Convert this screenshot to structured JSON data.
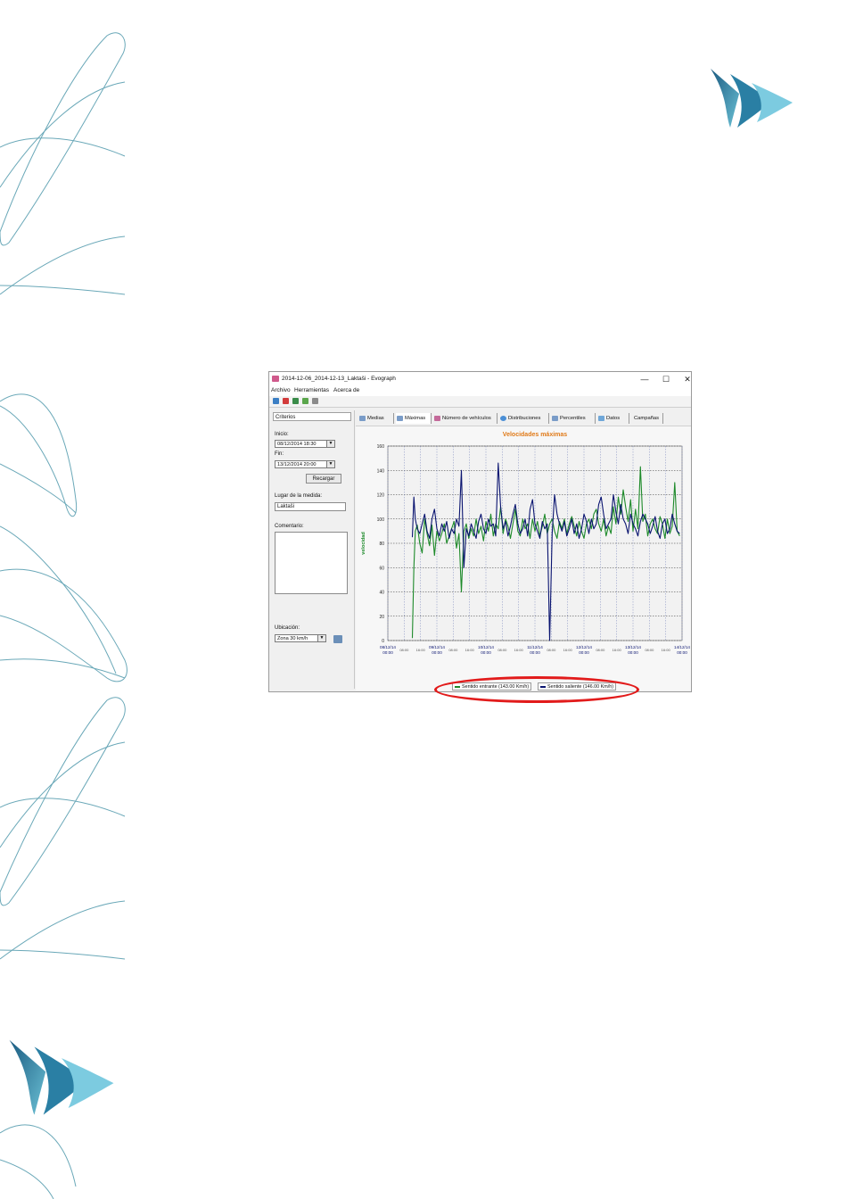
{
  "window": {
    "title": "2014-12-06_2014-12-13_Laktaši - Evograph",
    "controls": {
      "minimize": "—",
      "maximize": "☐",
      "close": "✕"
    }
  },
  "menu": [
    "Archivo",
    "Herramientas",
    "Acerca de"
  ],
  "toolbar_icons": [
    "open-folder-icon",
    "pdf-icon",
    "save-icon",
    "export-icon",
    "print-icon"
  ],
  "left_panel": {
    "header": "Criterios",
    "inicio_label": "Inicio:",
    "inicio_value": "08/12/2014 18:30",
    "fin_label": "Fin:",
    "fin_value": "13/12/2014 20:00",
    "reload_button": "Recargar",
    "lugar_label": "Lugar de la medida:",
    "lugar_value": "Laktaši",
    "comentario_label": "Comentario:",
    "comentario_value": "",
    "ubicacion_label": "Ubicación:",
    "ubicacion_value": "Zona 30 km/h"
  },
  "tabs": [
    "Medias",
    "Máximas",
    "Número de vehículos",
    "Distribuciones",
    "Percentiles",
    "Datos",
    "Campañas"
  ],
  "colors": {
    "incoming": "#1d8a2a",
    "outgoing": "#0a1470",
    "title": "#e07b1a",
    "highlight": "#e21b1b",
    "ylabel": "#1d8a2a"
  },
  "chart_data": {
    "type": "line",
    "title": "Velocidades máximas",
    "ylabel": "velocidad",
    "xlabel": "",
    "ylim": [
      0,
      160
    ],
    "yticks": [
      0,
      20,
      40,
      60,
      80,
      100,
      120,
      140,
      160
    ],
    "x_major_labels": [
      {
        "date": "08/12/14",
        "time": "00:00"
      },
      {
        "date": "09/12/14",
        "time": "00:00"
      },
      {
        "date": "10/12/14",
        "time": "00:00"
      },
      {
        "date": "11/12/14",
        "time": "00:00"
      },
      {
        "date": "12/12/14",
        "time": "00:00"
      },
      {
        "date": "13/12/14",
        "time": "00:00"
      },
      {
        "date": "14/12/14",
        "time": "00:00"
      }
    ],
    "x_minor_labels": [
      "08:00",
      "16:00"
    ],
    "x_range_days": [
      0,
      6
    ],
    "series": [
      {
        "name": "Sentido entrante (143.00 Km/h)",
        "x_days": [
          0.5,
          0.53,
          0.56,
          0.6,
          0.65,
          0.7,
          0.75,
          0.8,
          0.85,
          0.9,
          0.95,
          1.0,
          1.05,
          1.1,
          1.15,
          1.2,
          1.25,
          1.3,
          1.35,
          1.4,
          1.45,
          1.5,
          1.55,
          1.6,
          1.65,
          1.7,
          1.75,
          1.8,
          1.85,
          1.9,
          1.95,
          2.0,
          2.05,
          2.1,
          2.15,
          2.2,
          2.25,
          2.3,
          2.35,
          2.4,
          2.45,
          2.5,
          2.55,
          2.6,
          2.65,
          2.7,
          2.75,
          2.8,
          2.85,
          2.9,
          2.95,
          3.0,
          3.05,
          3.1,
          3.15,
          3.2,
          3.25,
          3.3,
          3.35,
          3.4,
          3.45,
          3.5,
          3.55,
          3.6,
          3.65,
          3.7,
          3.75,
          3.8,
          3.85,
          3.9,
          3.95,
          4.0,
          4.05,
          4.1,
          4.15,
          4.2,
          4.25,
          4.3,
          4.35,
          4.4,
          4.45,
          4.5,
          4.55,
          4.6,
          4.65,
          4.7,
          4.75,
          4.8,
          4.85,
          4.9,
          4.95,
          5.0,
          5.05,
          5.1,
          5.15,
          5.2,
          5.25,
          5.3,
          5.35,
          5.4,
          5.45,
          5.5,
          5.55,
          5.6,
          5.65,
          5.7,
          5.75,
          5.8,
          5.85,
          5.9,
          5.95
        ],
        "values": [
          2,
          60,
          90,
          95,
          80,
          72,
          100,
          88,
          78,
          95,
          70,
          90,
          82,
          88,
          96,
          80,
          86,
          92,
          98,
          76,
          88,
          40,
          90,
          96,
          84,
          92,
          86,
          100,
          88,
          94,
          82,
          98,
          90,
          104,
          86,
          96,
          92,
          110,
          88,
          100,
          94,
          84,
          96,
          108,
          90,
          86,
          100,
          92,
          96,
          84,
          100,
          90,
          98,
          86,
          94,
          104,
          88,
          96,
          100,
          90,
          84,
          98,
          92,
          100,
          88,
          96,
          102,
          94,
          86,
          98,
          90,
          84,
          96,
          100,
          92,
          104,
          108,
          96,
          90,
          100,
          86,
          94,
          88,
          110,
          96,
          118,
          104,
          124,
          110,
          98,
          116,
          90,
          108,
          92,
          143,
          98,
          104,
          86,
          96,
          100,
          92,
          88,
          102,
          96,
          84,
          100,
          88,
          94,
          130,
          90,
          86,
          96,
          90
        ]
      },
      {
        "name": "Sentido saliente (146.00 Km/h)",
        "x_days": [
          0.5,
          0.53,
          0.56,
          0.6,
          0.65,
          0.7,
          0.75,
          0.8,
          0.85,
          0.9,
          0.95,
          1.0,
          1.05,
          1.1,
          1.15,
          1.2,
          1.25,
          1.3,
          1.35,
          1.4,
          1.45,
          1.5,
          1.55,
          1.6,
          1.65,
          1.7,
          1.75,
          1.8,
          1.85,
          1.9,
          1.95,
          2.0,
          2.05,
          2.1,
          2.15,
          2.2,
          2.25,
          2.3,
          2.35,
          2.4,
          2.45,
          2.5,
          2.55,
          2.6,
          2.65,
          2.7,
          2.75,
          2.8,
          2.85,
          2.9,
          2.95,
          3.0,
          3.05,
          3.1,
          3.15,
          3.2,
          3.25,
          3.3,
          3.35,
          3.4,
          3.45,
          3.5,
          3.55,
          3.6,
          3.65,
          3.7,
          3.75,
          3.8,
          3.85,
          3.9,
          3.95,
          4.0,
          4.05,
          4.1,
          4.15,
          4.2,
          4.25,
          4.3,
          4.35,
          4.4,
          4.45,
          4.5,
          4.55,
          4.6,
          4.65,
          4.7,
          4.75,
          4.8,
          4.85,
          4.9,
          4.95,
          5.0,
          5.05,
          5.1,
          5.15,
          5.2,
          5.25,
          5.3,
          5.35,
          5.4,
          5.45,
          5.5,
          5.55,
          5.6,
          5.65,
          5.7,
          5.75,
          5.8,
          5.85,
          5.9,
          5.95
        ],
        "values": [
          85,
          118,
          100,
          92,
          88,
          96,
          104,
          90,
          84,
          100,
          108,
          92,
          86,
          96,
          90,
          98,
          84,
          92,
          88,
          100,
          94,
          140,
          60,
          92,
          86,
          96,
          90,
          84,
          98,
          104,
          92,
          88,
          100,
          94,
          96,
          86,
          146,
          110,
          92,
          98,
          86,
          94,
          104,
          112,
          96,
          88,
          92,
          100,
          86,
          108,
          116,
          96,
          90,
          84,
          98,
          92,
          96,
          0,
          88,
          120,
          104,
          96,
          90,
          98,
          86,
          92,
          100,
          88,
          96,
          84,
          92,
          104,
          98,
          88,
          100,
          92,
          96,
          112,
          118,
          104,
          92,
          96,
          100,
          120,
          106,
          96,
          112,
          100,
          96,
          88,
          104,
          96,
          92,
          86,
          98,
          104,
          100,
          96,
          88,
          94,
          102,
          90,
          84,
          96,
          100,
          88,
          92,
          104,
          96,
          90,
          88,
          100,
          92
        ]
      }
    ],
    "grid": true,
    "legend": "bottom"
  }
}
